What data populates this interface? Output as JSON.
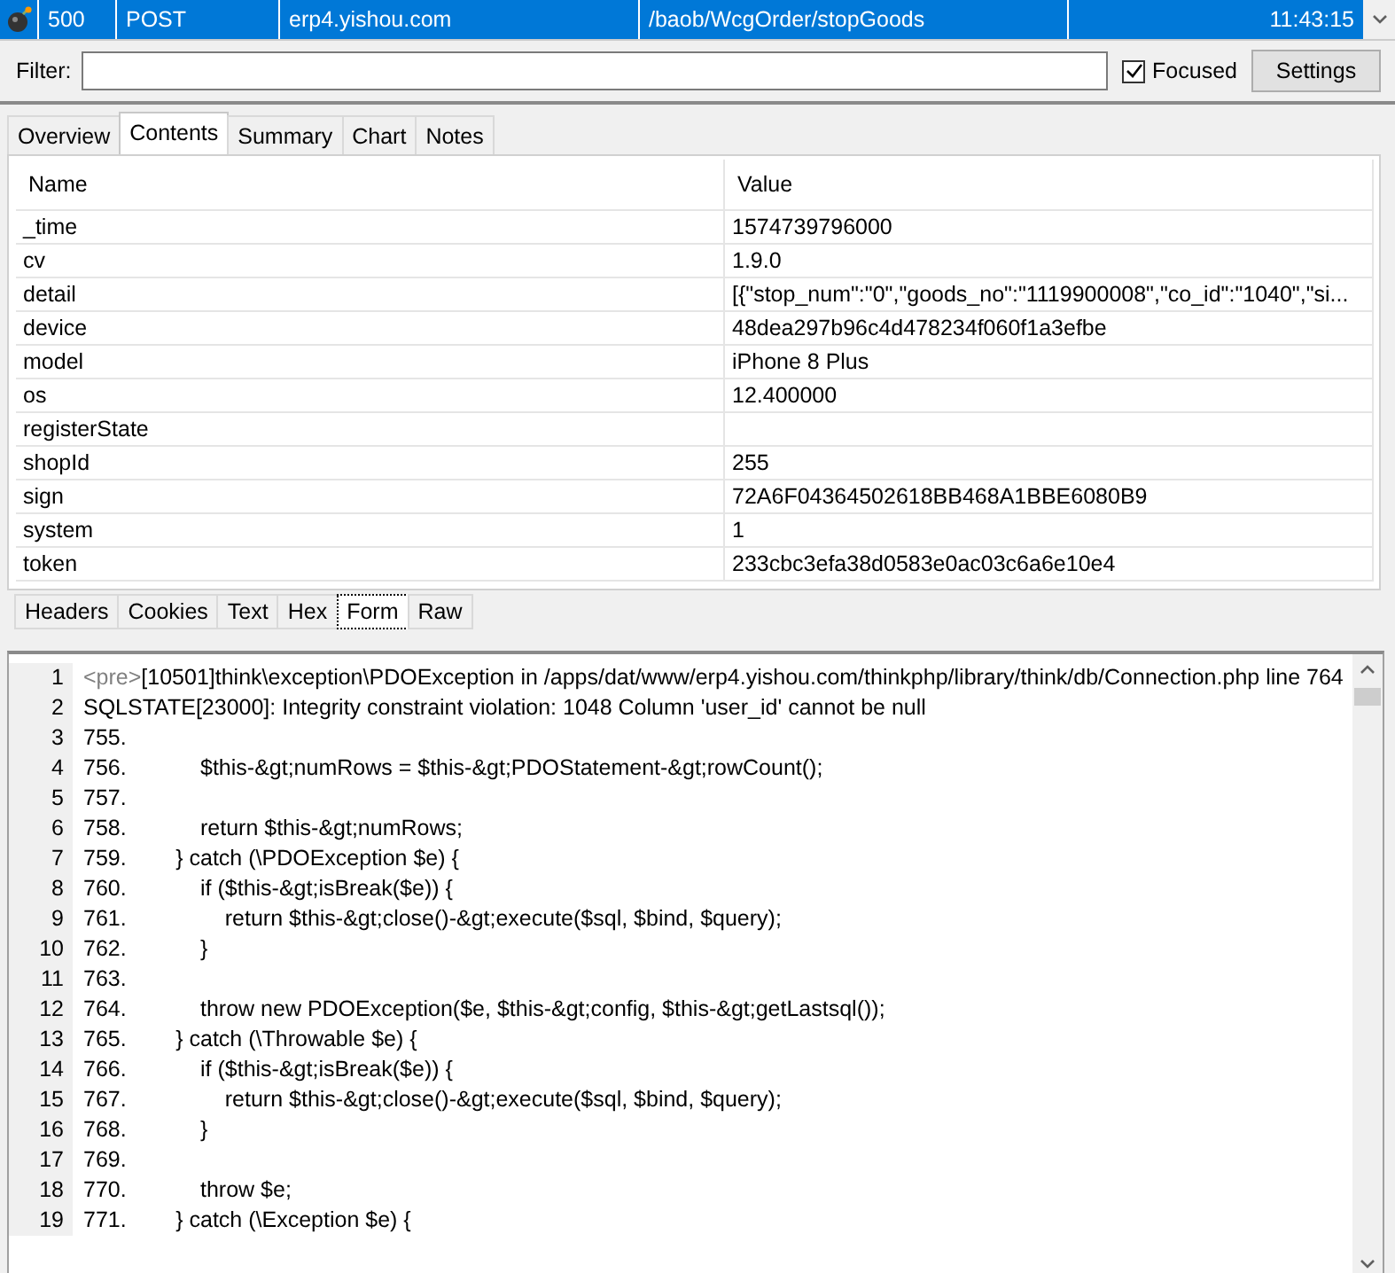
{
  "session": {
    "result": "500",
    "method": "POST",
    "host": "erp4.yishou.com",
    "url": "/baob/WcgOrder/stopGoods",
    "time": "11:43:15",
    "selected": true
  },
  "filter": {
    "label": "Filter:",
    "focused_label": "Focused",
    "focused_checked": true,
    "settings_button": "Settings"
  },
  "tabs": [
    {
      "label": "Overview",
      "selected": false
    },
    {
      "label": "Contents",
      "selected": true
    },
    {
      "label": "Summary",
      "selected": false
    },
    {
      "label": "Chart",
      "selected": false
    },
    {
      "label": "Notes",
      "selected": false
    }
  ],
  "table": {
    "columns": [
      "Name",
      "Value"
    ],
    "rows": [
      {
        "name": "_time",
        "value": "1574739796000"
      },
      {
        "name": "cv",
        "value": "1.9.0"
      },
      {
        "name": "detail",
        "value": "[{\"stop_num\":\"0\",\"goods_no\":\"1119900008\",\"co_id\":\"1040\",\"si..."
      },
      {
        "name": "device",
        "value": "48dea297b96c4d478234f060f1a3efbe"
      },
      {
        "name": "model",
        "value": "iPhone 8 Plus"
      },
      {
        "name": "os",
        "value": "12.400000"
      },
      {
        "name": "registerState"
      },
      {
        "name": "shopId",
        "value": "255"
      },
      {
        "name": "sign",
        "value": "72A6F04364502618BB468A1BBE6080B9"
      },
      {
        "name": "system",
        "value": "1"
      },
      {
        "name": "token",
        "value": "233cbc3efa38d0583e0ac03c6a6e10e4"
      }
    ]
  },
  "response_tabs": [
    {
      "label": "Headers",
      "selected": false
    },
    {
      "label": "Cookies",
      "selected": false
    },
    {
      "label": "Text",
      "selected": false
    },
    {
      "label": "Hex",
      "selected": false
    },
    {
      "label": "Form",
      "selected": true
    },
    {
      "label": "Raw",
      "selected": false
    }
  ],
  "code_lines": [
    {
      "number": "1",
      "tag": "<pre>",
      "text": "[10501]think\\exception\\PDOException in /apps/dat/www/erp4.yishou.com/thinkphp/library/think/db/Connection.php line 764"
    },
    {
      "number": "2",
      "text": "SQLSTATE[23000]: Integrity constraint violation: 1048 Column 'user_id' cannot be null"
    },
    {
      "number": "3",
      "text": "755."
    },
    {
      "number": "4",
      "text": "756.            $this-&gt;numRows = $this-&gt;PDOStatement-&gt;rowCount();"
    },
    {
      "number": "5",
      "text": "757."
    },
    {
      "number": "6",
      "text": "758.            return $this-&gt;numRows;"
    },
    {
      "number": "7",
      "text": "759.        } catch (\\PDOException $e) {"
    },
    {
      "number": "8",
      "text": "760.            if ($this-&gt;isBreak($e)) {"
    },
    {
      "number": "9",
      "text": "761.                return $this-&gt;close()-&gt;execute($sql, $bind, $query);"
    },
    {
      "number": "10",
      "text": "762.            }"
    },
    {
      "number": "11",
      "text": "763."
    },
    {
      "number": "12",
      "text": "764.            throw new PDOException($e, $this-&gt;config, $this-&gt;getLastsql());"
    },
    {
      "number": "13",
      "text": "765.        } catch (\\Throwable $e) {"
    },
    {
      "number": "14",
      "text": "766.            if ($this-&gt;isBreak($e)) {"
    },
    {
      "number": "15",
      "text": "767.                return $this-&gt;close()-&gt;execute($sql, $bind, $query);"
    },
    {
      "number": "16",
      "text": "768.            }"
    },
    {
      "number": "17",
      "text": "769."
    },
    {
      "number": "18",
      "text": "770.            throw $e;"
    },
    {
      "number": "19",
      "text": "771.        } catch (\\Exception $e) {"
    }
  ]
}
